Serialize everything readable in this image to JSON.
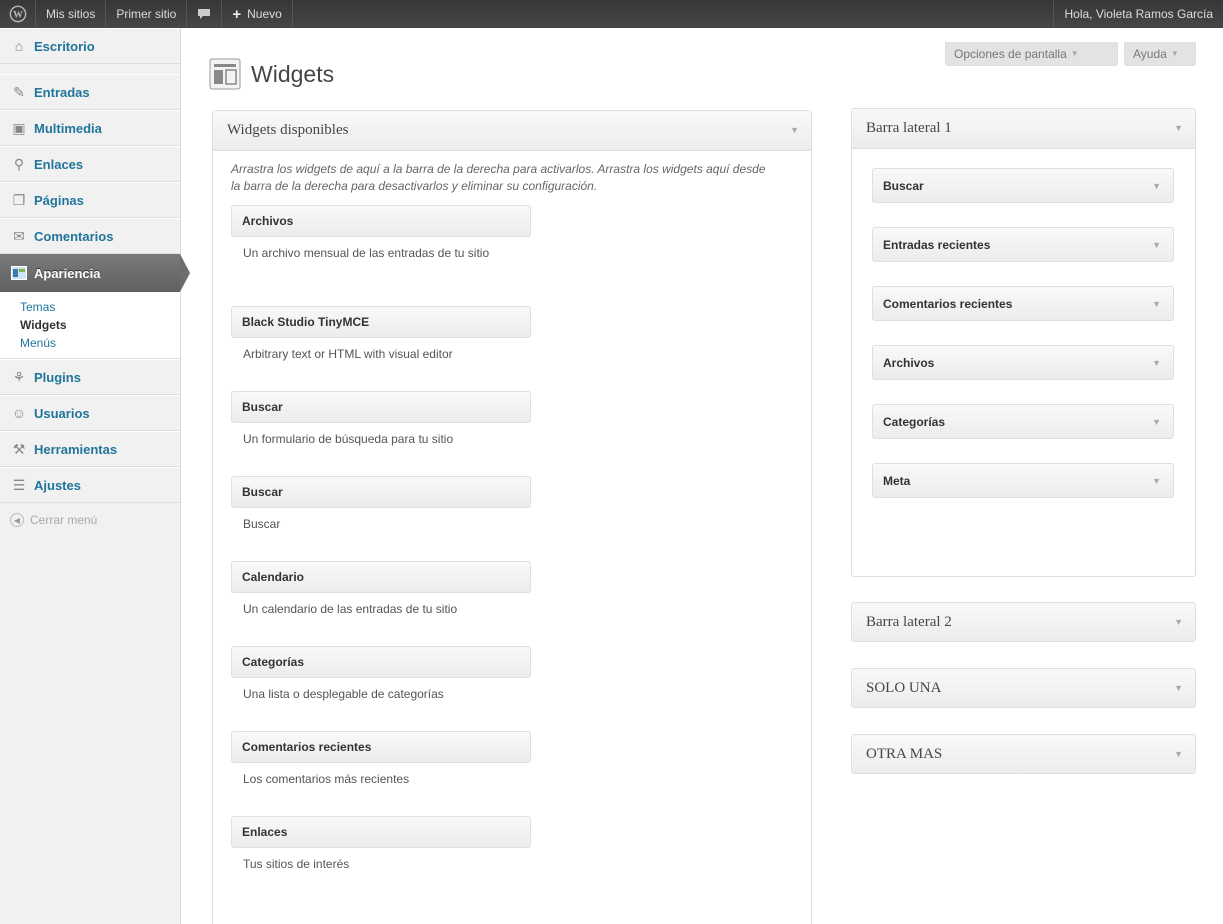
{
  "adminbar": {
    "my_sites": "Mis sitios",
    "site_name": "Primer sitio",
    "new_label": "Nuevo",
    "account": "Hola, Violeta Ramos García"
  },
  "sidebar": {
    "items_top": [
      {
        "label": "Escritorio",
        "icon": "home-icon"
      }
    ],
    "items": [
      {
        "label": "Entradas",
        "icon": "pin-icon"
      },
      {
        "label": "Multimedia",
        "icon": "media-icon"
      },
      {
        "label": "Enlaces",
        "icon": "link-icon"
      },
      {
        "label": "Páginas",
        "icon": "page-icon"
      },
      {
        "label": "Comentarios",
        "icon": "comment-icon"
      }
    ],
    "active": {
      "label": "Apariencia",
      "icon": "appearance-icon"
    },
    "submenu": [
      "Temas",
      "Widgets",
      "Menús"
    ],
    "items_bottom": [
      {
        "label": "Plugins",
        "icon": "plugin-icon"
      },
      {
        "label": "Usuarios",
        "icon": "users-icon"
      },
      {
        "label": "Herramientas",
        "icon": "tools-icon"
      },
      {
        "label": "Ajustes",
        "icon": "settings-icon"
      }
    ],
    "collapse": "Cerrar menú"
  },
  "header": {
    "screen_options": "Opciones de pantalla",
    "help": "Ayuda",
    "title": "Widgets"
  },
  "available": {
    "title": "Widgets disponibles",
    "description": "Arrastra los widgets de aquí a la barra de la derecha para activarlos. Arrastra los widgets aquí desde la barra de la derecha para desactivarlos y eliminar su configuración.",
    "widgets": [
      {
        "name": "Archivos",
        "desc": "Un archivo mensual de las entradas de tu sitio"
      },
      {
        "name": "Black Studio TinyMCE",
        "desc": "Arbitrary text or HTML with visual editor"
      },
      {
        "name": "Buscar",
        "desc": "Un formulario de búsqueda para tu sitio"
      },
      {
        "name": "Buscar",
        "desc": "Buscar"
      },
      {
        "name": "Calendario",
        "desc": "Un calendario de las entradas de tu sitio"
      },
      {
        "name": "Categorías",
        "desc": "Una lista o desplegable de categorías"
      },
      {
        "name": "Comentarios recientes",
        "desc": "Los comentarios más recientes"
      },
      {
        "name": "Enlaces",
        "desc": "Tus sitios de interés"
      }
    ]
  },
  "sidebar1": {
    "title": "Barra lateral 1",
    "widgets": [
      "Buscar",
      "Entradas recientes",
      "Comentarios recientes",
      "Archivos",
      "Categorías",
      "Meta"
    ]
  },
  "other_sidebars": [
    "Barra lateral 2",
    "SOLO UNA",
    "OTRA MAS"
  ]
}
